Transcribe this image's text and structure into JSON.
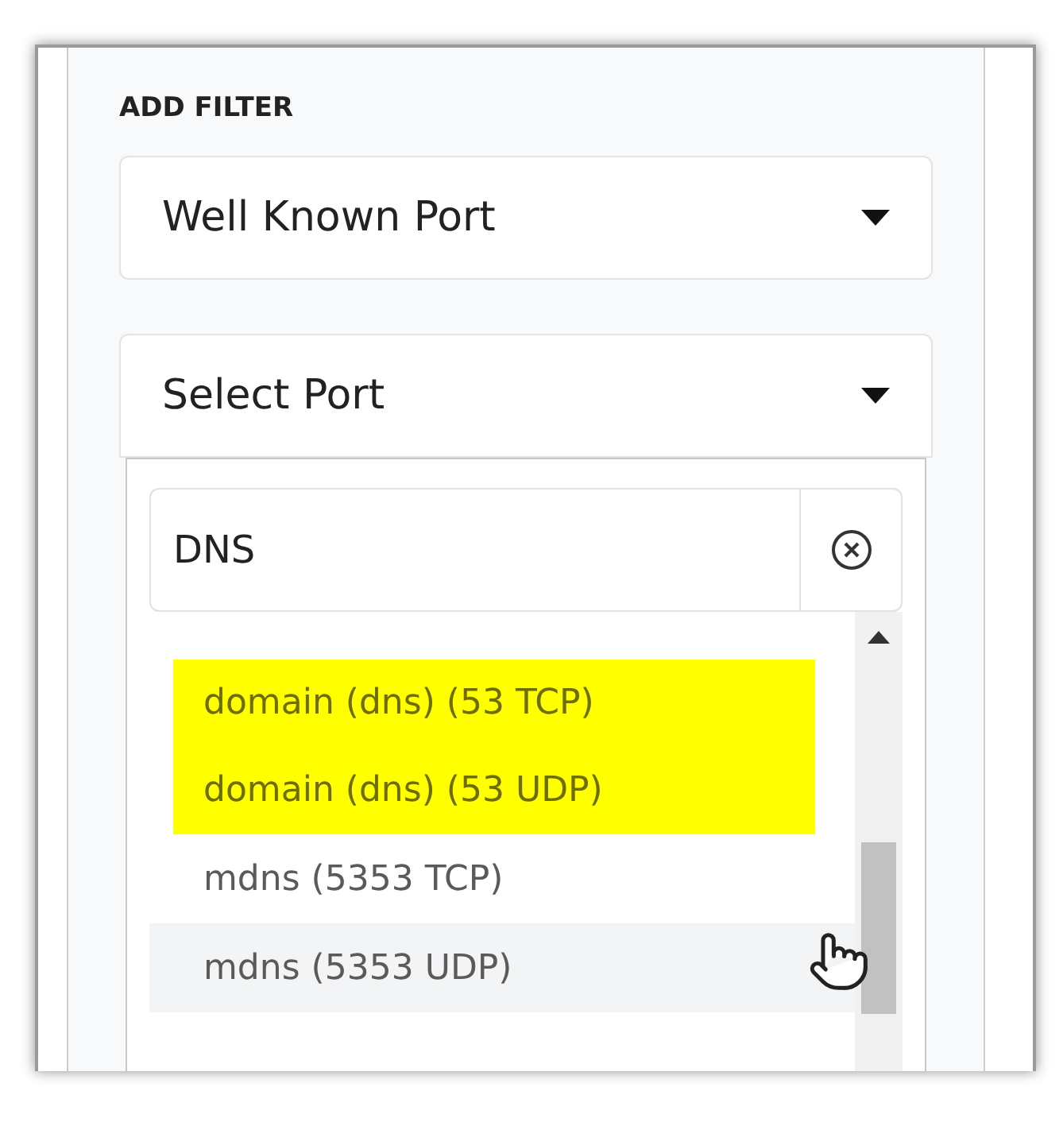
{
  "heading": "ADD FILTER",
  "selects": [
    {
      "value": "Well Known Port",
      "open": false
    },
    {
      "value": "Select Port",
      "open": true
    }
  ],
  "search": {
    "value": "DNS"
  },
  "options": [
    {
      "label": "domain (dns) (53 TCP)",
      "highlighted": true,
      "hovered": false
    },
    {
      "label": "domain (dns) (53 UDP)",
      "highlighted": true,
      "hovered": false
    },
    {
      "label": "mdns (5353 TCP)",
      "highlighted": false,
      "hovered": false
    },
    {
      "label": "mdns (5353 UDP)",
      "highlighted": false,
      "hovered": true
    }
  ]
}
